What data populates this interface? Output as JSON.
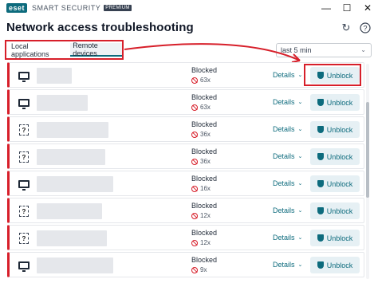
{
  "window": {
    "logo": "eset",
    "brand": "SMART SECURITY",
    "edition": "PREMIUM",
    "controls": [
      "minimize-icon",
      "maximize-icon",
      "close-icon"
    ]
  },
  "header": {
    "title": "Network access troubleshooting",
    "icons": [
      "refresh-icon",
      "help-icon"
    ]
  },
  "tabs": [
    {
      "label": "Local applications",
      "active": false
    },
    {
      "label": "Remote devices",
      "active": true
    }
  ],
  "filter": {
    "selected": "last 5 min"
  },
  "rows": [
    {
      "icon": "monitor",
      "status": "Blocked",
      "count": "63x",
      "details": "Details",
      "action": "Unblock"
    },
    {
      "icon": "monitor",
      "status": "Blocked",
      "count": "63x",
      "details": "Details",
      "action": "Unblock"
    },
    {
      "icon": "unknown",
      "status": "Blocked",
      "count": "36x",
      "details": "Details",
      "action": "Unblock"
    },
    {
      "icon": "unknown",
      "status": "Blocked",
      "count": "36x",
      "details": "Details",
      "action": "Unblock"
    },
    {
      "icon": "monitor",
      "status": "Blocked",
      "count": "16x",
      "details": "Details",
      "action": "Unblock"
    },
    {
      "icon": "unknown",
      "status": "Blocked",
      "count": "12x",
      "details": "Details",
      "action": "Unblock"
    },
    {
      "icon": "unknown",
      "status": "Blocked",
      "count": "12x",
      "details": "Details",
      "action": "Unblock"
    },
    {
      "icon": "monitor",
      "status": "Blocked",
      "count": "9x",
      "details": "Details",
      "action": "Unblock"
    }
  ],
  "colors": {
    "accent": "#0d6b7d",
    "blocked": "#d71f2a",
    "highlight": "#d71f2a"
  }
}
